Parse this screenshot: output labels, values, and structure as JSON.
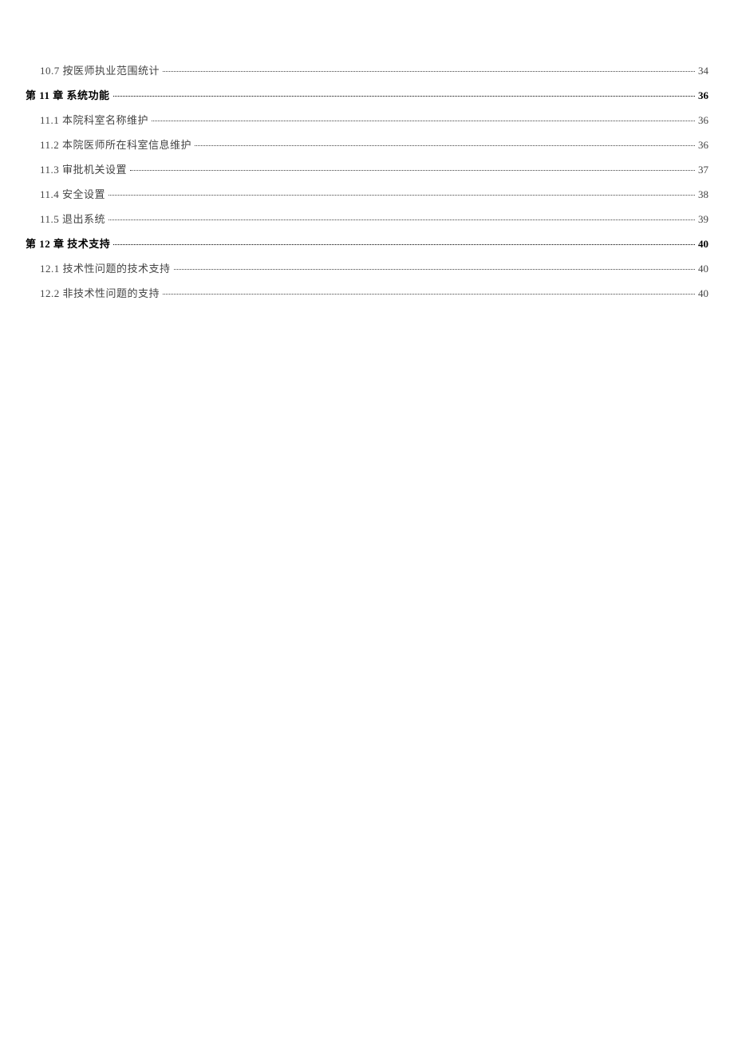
{
  "toc": [
    {
      "type": "section",
      "label": "10.7 按医师执业范围统计",
      "page": "34"
    },
    {
      "type": "chapter",
      "label": "第 11 章  系统功能",
      "page": "36"
    },
    {
      "type": "section",
      "label": "11.1 本院科室名称维护",
      "page": "36"
    },
    {
      "type": "section",
      "label": "11.2 本院医师所在科室信息维护",
      "page": "36"
    },
    {
      "type": "section",
      "label": "11.3 审批机关设置",
      "page": "37"
    },
    {
      "type": "section",
      "label": "11.4 安全设置",
      "page": "38"
    },
    {
      "type": "section",
      "label": "11.5 退出系统",
      "page": "39"
    },
    {
      "type": "chapter",
      "label": "第 12 章  技术支持",
      "page": "40"
    },
    {
      "type": "section",
      "label": "12.1 技术性问题的技术支持",
      "page": "40"
    },
    {
      "type": "section",
      "label": "12.2 非技术性问题的支持",
      "page": "40"
    }
  ]
}
